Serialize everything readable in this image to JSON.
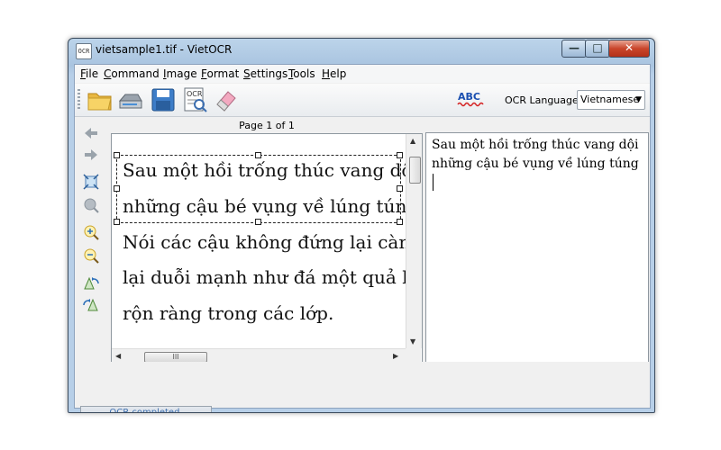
{
  "window": {
    "title": "vietsample1.tif - VietOCR",
    "app_icon_text": "OCR"
  },
  "menu": [
    {
      "accel": "F",
      "rest": "ile"
    },
    {
      "accel": "C",
      "rest": "ommand"
    },
    {
      "accel": "I",
      "rest": "mage"
    },
    {
      "accel": "F",
      "rest": "ormat"
    },
    {
      "accel": "S",
      "rest": "ettings"
    },
    {
      "accel": "T",
      "rest": "ools"
    },
    {
      "accel": "H",
      "rest": "elp"
    }
  ],
  "toolbar": {
    "spellcheck_icon_text": "ABC",
    "ocr_icon_text": "OCR",
    "ocr_language_label": "OCR Language",
    "ocr_language_value": "Vietnamese"
  },
  "image_panel": {
    "page_label": "Page 1 of 1",
    "lines": [
      "Sau một hồi trống thúc vang dội c",
      "những cậu bé vụng về lúng túng n",
      "Nói các cậu không đứng lại càng",
      "lại duỗi mạnh như đá một quả ban",
      "rộn ràng trong các lớp."
    ],
    "hscroll_thumb": "III"
  },
  "text_panel": {
    "lines": [
      "Sau một hồi trống thúc vang dội",
      "những cậu bé vụng về lúng túng"
    ]
  },
  "status": {
    "text": "OCR completed."
  }
}
